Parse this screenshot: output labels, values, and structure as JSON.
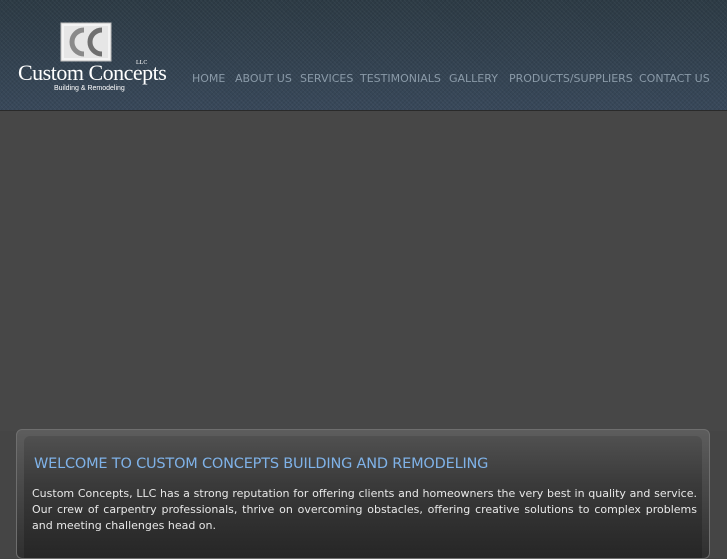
{
  "logo": {
    "name": "Custom Concepts",
    "llc": "LLC",
    "tagline": "Building & Remodeling"
  },
  "nav": {
    "items": [
      {
        "label": "HOME"
      },
      {
        "label": "ABOUT US"
      },
      {
        "label": "SERVICES"
      },
      {
        "label": "TESTIMONIALS"
      },
      {
        "label": "GALLERY"
      },
      {
        "label": "PRODUCTS/SUPPLIERS"
      },
      {
        "label": "CONTACT US"
      }
    ]
  },
  "welcome": {
    "title": "WELCOME TO CUSTOM CONCEPTS BUILDING AND REMODELING",
    "text": "Custom Concepts, LLC has a strong reputation for offering clients and homeowners the very best in quality and service. Our crew of carpentry professionals, thrive on overcoming obstacles, offering creative solutions to complex problems and meeting challenges head on."
  },
  "colors": {
    "nav_text": "#8a9aa8",
    "title_accent": "#7fb2e8",
    "header_bg": "#33434f",
    "page_bg": "#454545"
  }
}
